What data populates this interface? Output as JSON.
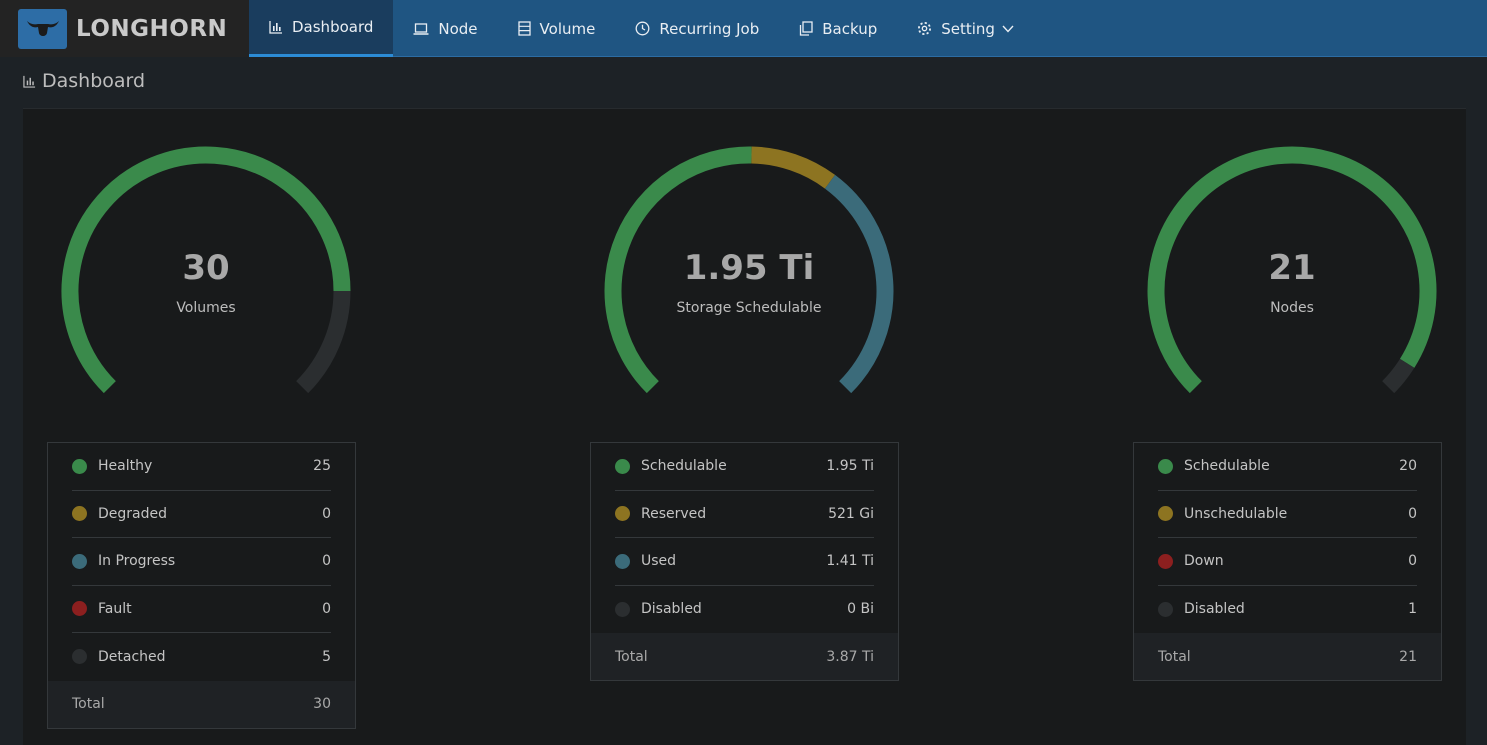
{
  "brand": {
    "name": "LONGHORN"
  },
  "nav": [
    {
      "label": "Dashboard",
      "icon": "bar-chart-icon",
      "active": true
    },
    {
      "label": "Node",
      "icon": "laptop-icon"
    },
    {
      "label": "Volume",
      "icon": "database-icon"
    },
    {
      "label": "Recurring Job",
      "icon": "clock-icon"
    },
    {
      "label": "Backup",
      "icon": "copy-icon"
    },
    {
      "label": "Setting",
      "icon": "gear-icon",
      "dropdown": true
    }
  ],
  "page": {
    "title": "Dashboard"
  },
  "colors": {
    "green": "#3a8a4b",
    "yellow": "#8d7421",
    "teal": "#3b6b7a",
    "red": "#8c1f1f",
    "gray": "#2b2e30"
  },
  "gauges": [
    {
      "value": "30",
      "label": "Volumes",
      "segments": [
        {
          "color": "green",
          "fraction": 0.8333
        },
        {
          "color": "gray",
          "fraction": 0.1667
        }
      ],
      "legend": [
        {
          "label": "Healthy",
          "count": "25",
          "color": "green"
        },
        {
          "label": "Degraded",
          "count": "0",
          "color": "yellow"
        },
        {
          "label": "In Progress",
          "count": "0",
          "color": "teal"
        },
        {
          "label": "Fault",
          "count": "0",
          "color": "red"
        },
        {
          "label": "Detached",
          "count": "5",
          "color": "gray"
        }
      ],
      "total_label": "Total",
      "total": "30"
    },
    {
      "value": "1.95 Ti",
      "label": "Storage Schedulable",
      "segments": [
        {
          "color": "green",
          "fraction": 0.5039
        },
        {
          "color": "yellow",
          "fraction": 0.1315
        },
        {
          "color": "teal",
          "fraction": 0.3646
        }
      ],
      "legend": [
        {
          "label": "Schedulable",
          "count": "1.95 Ti",
          "color": "green"
        },
        {
          "label": "Reserved",
          "count": "521 Gi",
          "color": "yellow"
        },
        {
          "label": "Used",
          "count": "1.41 Ti",
          "color": "teal"
        },
        {
          "label": "Disabled",
          "count": "0 Bi",
          "color": "gray"
        }
      ],
      "total_label": "Total",
      "total": "3.87 Ti"
    },
    {
      "value": "21",
      "label": "Nodes",
      "segments": [
        {
          "color": "green",
          "fraction": 0.9524
        },
        {
          "color": "gray",
          "fraction": 0.0476
        }
      ],
      "legend": [
        {
          "label": "Schedulable",
          "count": "20",
          "color": "green"
        },
        {
          "label": "Unschedulable",
          "count": "0",
          "color": "yellow"
        },
        {
          "label": "Down",
          "count": "0",
          "color": "red"
        },
        {
          "label": "Disabled",
          "count": "1",
          "color": "gray"
        }
      ],
      "total_label": "Total",
      "total": "21"
    }
  ]
}
